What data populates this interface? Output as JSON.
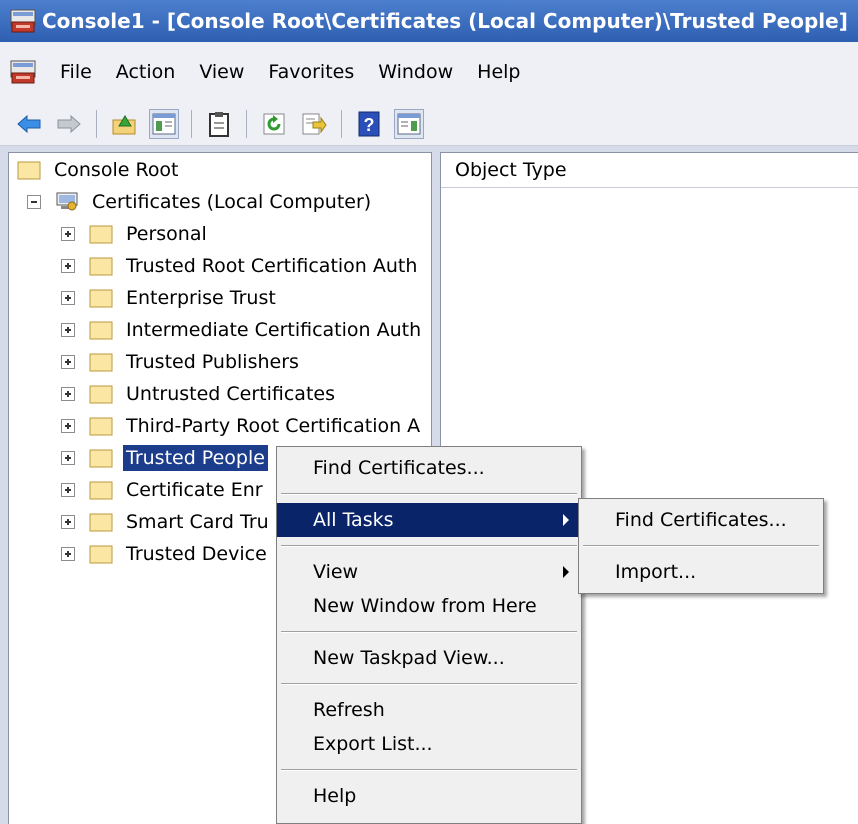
{
  "title": "Console1 - [Console Root\\Certificates (Local Computer)\\Trusted People]",
  "menubar": [
    "File",
    "Action",
    "View",
    "Favorites",
    "Window",
    "Help"
  ],
  "column_header": "Object Type",
  "tree": {
    "root": "Console Root",
    "computer": "Certificates (Local Computer)",
    "items": [
      "Personal",
      "Trusted Root Certification Auth",
      "Enterprise Trust",
      "Intermediate Certification Auth",
      "Trusted Publishers",
      "Untrusted Certificates",
      "Third-Party Root Certification A",
      "Trusted People",
      "Certificate Enr",
      "Smart Card Tru",
      "Trusted Device"
    ]
  },
  "context_menu": {
    "find": "Find Certificates...",
    "all_tasks": "All Tasks",
    "view": "View",
    "new_window": "New Window from Here",
    "new_taskpad": "New Taskpad View...",
    "refresh": "Refresh",
    "export": "Export List...",
    "help": "Help"
  },
  "submenu": {
    "find": "Find Certificates...",
    "import": "Import..."
  },
  "colors": {
    "titlebar": "#2e5fb0",
    "selection": "#1c3c8c",
    "menu_highlight": "#0a246a"
  }
}
